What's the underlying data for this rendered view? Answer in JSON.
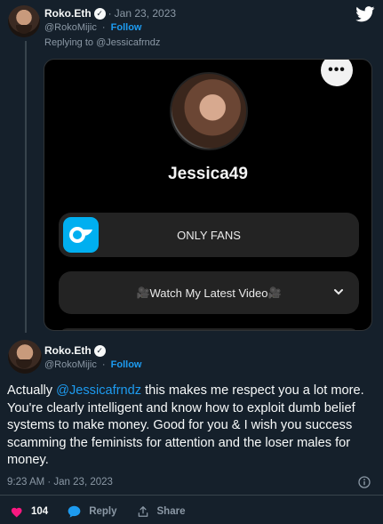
{
  "reply_tweet": {
    "author_name": "Roko.Eth",
    "verified_mark": "✓",
    "handle": "@RokoMijic",
    "date": "Jan 23, 2023",
    "follow_label": "Follow",
    "replying_to_prefix": "Replying to",
    "replying_to_handle": "@Jessicafrndz"
  },
  "embedded_card": {
    "more_label": "•••",
    "profile_name": "Jessica49",
    "link1_label": "ONLY FANS",
    "link2_label": "Watch My Latest Video",
    "link2_emoji": "🎥"
  },
  "main_tweet": {
    "author_name": "Roko.Eth",
    "handle": "@RokoMijic",
    "follow_label": "Follow",
    "text_prefix": "Actually ",
    "mention": "@Jessicafrndz",
    "text_suffix": " this makes me respect you a lot more. You're clearly intelligent and know how to exploit dumb belief systems to make money. Good for you & I wish you success scamming the feminists for attention and the loser males for money.",
    "timestamp": "9:23 AM · Jan 23, 2023"
  },
  "actions": {
    "like_count": "104",
    "reply_label": "Reply",
    "share_label": "Share"
  },
  "colors": {
    "background": "#15202b",
    "accent": "#1d9bf0",
    "like": "#f91880",
    "onlyfans": "#00aff0"
  },
  "icons": [
    "twitter-logo-icon",
    "verified-icon",
    "more-icon",
    "onlyfans-logo-icon",
    "chevron-down-icon",
    "info-icon",
    "heart-icon",
    "reply-icon",
    "share-icon"
  ]
}
